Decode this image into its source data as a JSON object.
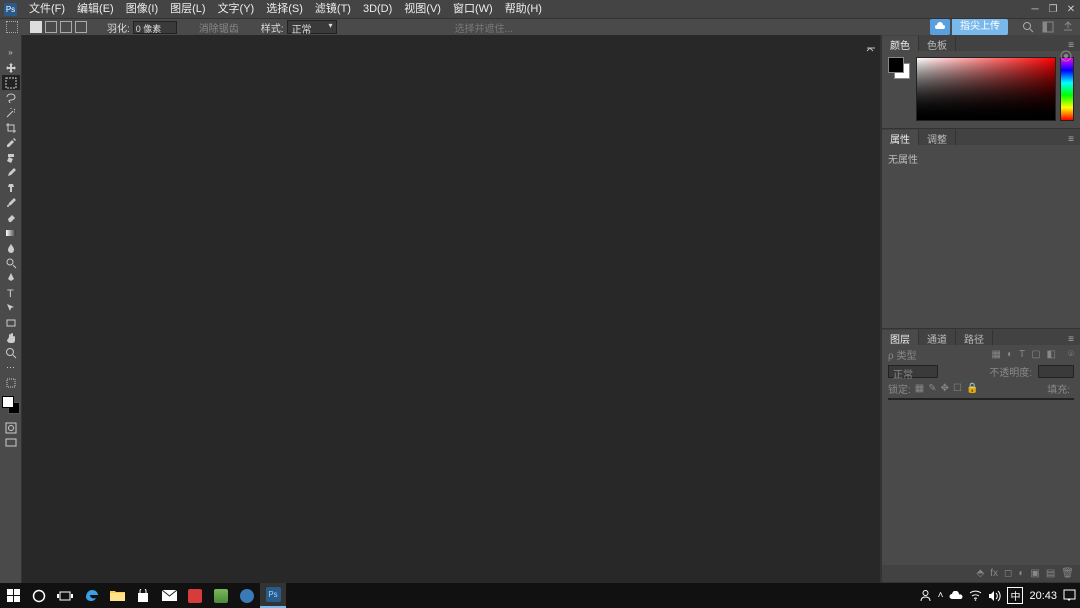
{
  "app": {
    "logo": "Ps"
  },
  "menu": {
    "file": "文件(F)",
    "edit": "编辑(E)",
    "image": "图像(I)",
    "layer": "图层(L)",
    "type": "文字(Y)",
    "select": "选择(S)",
    "filter": "滤镜(T)",
    "threeD": "3D(D)",
    "view": "视图(V)",
    "window": "窗口(W)",
    "help": "帮助(H)"
  },
  "options": {
    "feather_label": "羽化:",
    "feather_value": "0 像素",
    "antialias_label": "消除锯齿",
    "style_label": "样式:",
    "style_value": "正常",
    "mask_label": "选择并遮住...",
    "share_label": "指尖上传",
    "search_icon": "search",
    "workspace_icon": "workspace",
    "share_icon": "share"
  },
  "tools": [
    "move",
    "rect-marquee",
    "lasso",
    "magic-wand",
    "crop",
    "eyedropper",
    "spot-heal",
    "brush",
    "clone",
    "history-brush",
    "eraser",
    "gradient",
    "blur",
    "dodge",
    "pen",
    "type",
    "path-select",
    "rectangle",
    "hand",
    "zoom"
  ],
  "panels": {
    "color": {
      "tab1": "颜色",
      "tab2": "色板"
    },
    "props": {
      "tab1": "属性",
      "tab2": "调整",
      "no_props": "无属性"
    },
    "layers": {
      "tab1": "图层",
      "tab2": "通道",
      "tab3": "路径",
      "kind_label": "ρ 类型",
      "blend_label": "正常",
      "opacity_label": "不透明度:",
      "lock_label": "锁定:",
      "fill_label": "填充:"
    }
  },
  "taskbar": {
    "items": [
      "start",
      "cortana",
      "taskview",
      "edge",
      "files",
      "store",
      "mail",
      "app1",
      "app2",
      "app3",
      "photoshop"
    ],
    "clock": "20:43",
    "ime": "中"
  },
  "colors": {
    "accent": "#5aa0e0",
    "share": "#7ab8ec"
  }
}
